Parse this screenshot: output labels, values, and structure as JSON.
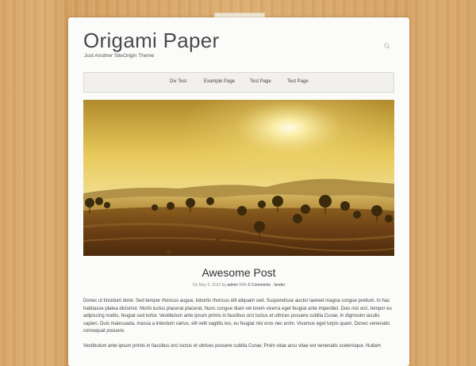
{
  "site": {
    "title": "Origami Paper",
    "tagline": "Just Another SiteOrigin Theme"
  },
  "search": {
    "icon": "search-icon"
  },
  "nav": {
    "items": [
      {
        "label": "Div Test"
      },
      {
        "label": "Example Page"
      },
      {
        "label": "Test Page"
      },
      {
        "label": "Test Page"
      }
    ]
  },
  "post": {
    "title": "Awesome Post",
    "meta": {
      "on": "On",
      "date": "May 5, 2013",
      "by": "by",
      "author": "admin",
      "with": "With",
      "comments": "0 Comments",
      "sep": "-",
      "category": "lender"
    },
    "paragraphs": [
      "Donec ut tincidunt dolor. Sed tempor rhoncus augue, lobortis rhoncus elit aliquam sed. Suspendisse auctor laoreet magna congue pretium. In hac habitasse platea dictumst. Morbi luctus placerat placerat. Nunc congue diam vel lorem viverra eget feugiat ante imperdiet. Duis nisi orci, tempor eu adipiscing mattis, feugiat sed tortor. Vestibulum ante ipsum primis in faucibus orci luctus et ultrices posuere cubilia Curae; In dignissim iaculis sapien. Duis malesuada, massa a interdum varius, elit velit sagittis leo, eu feugiat nisi eros nec enim. Vivamus eget turpis quam. Donec venenatis consequat posuere.",
      "Vestibulum ante ipsum primis in faucibus orci luctus et ultrices posuere cubilia Curae; Proin vitae arcu vitae est venenatis scelerisque. Nullam"
    ]
  },
  "colors": {
    "background_wood": "#d9a86a",
    "paper": "#fbfbfa",
    "nav_bg": "#f1f0ee",
    "text": "#444444"
  }
}
